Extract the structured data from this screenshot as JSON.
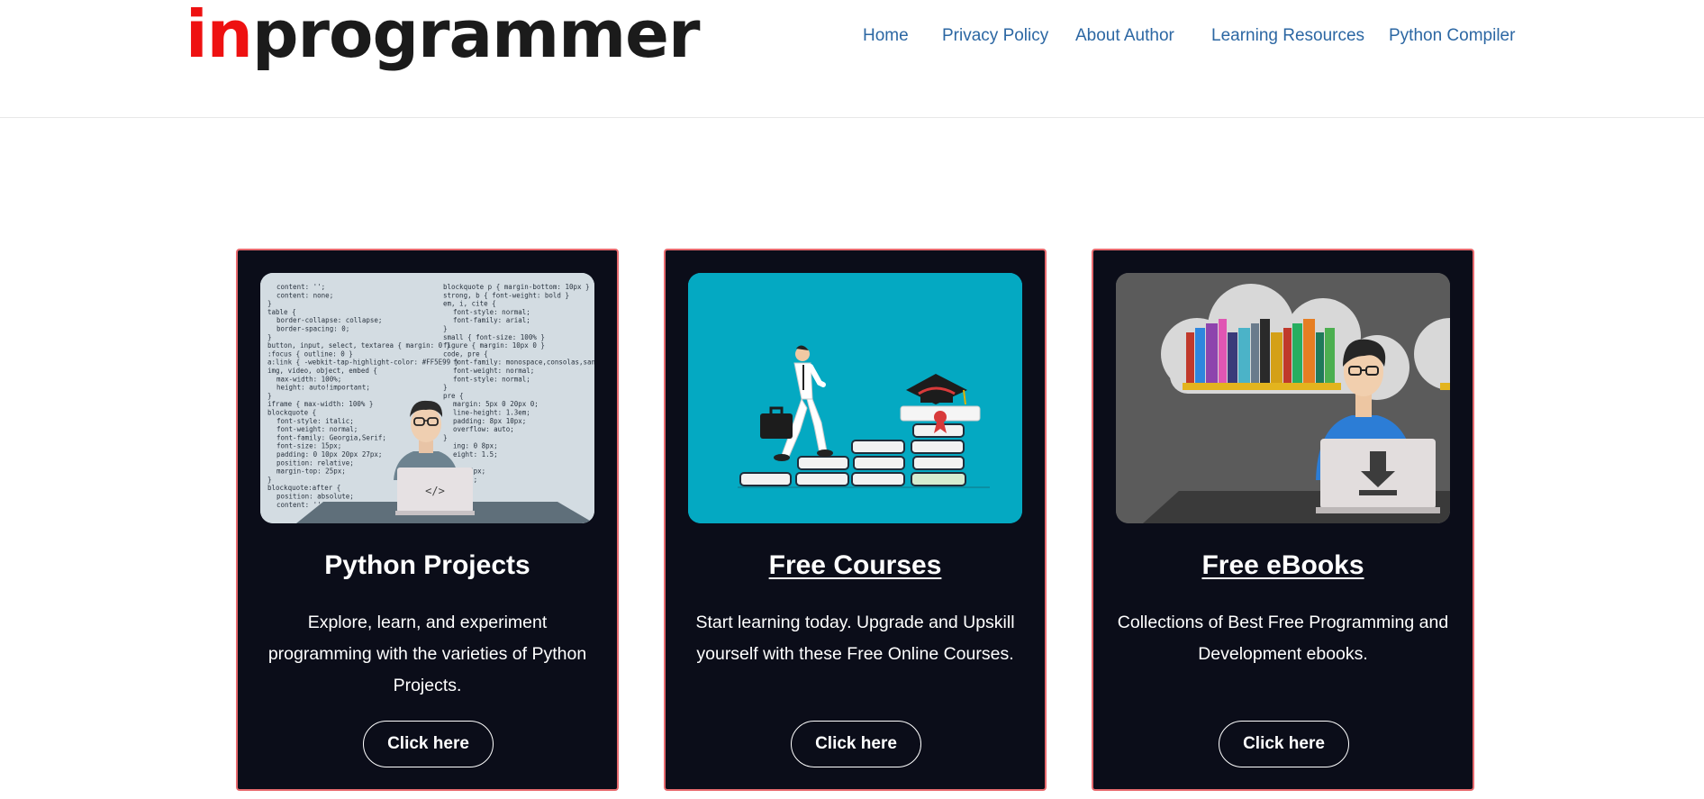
{
  "logo": {
    "part1": "in",
    "part2": "programmer"
  },
  "nav": [
    {
      "label": "Home"
    },
    {
      "label": "Privacy Policy"
    },
    {
      "label": "About Author"
    },
    {
      "label": "Learning Resources"
    },
    {
      "label": "Python Compiler"
    }
  ],
  "cards": [
    {
      "title": "Python Projects",
      "description": "Explore, learn, and experiment programming with the varieties of Python Projects.",
      "button": "Click here",
      "image": {
        "left_code": [
          "content: '';",
          "content: none;",
          "}",
          "table {",
          "border-collapse: collapse;",
          "border-spacing: 0;",
          "}",
          "button, input, select, textarea { margin: 0 }",
          ":focus { outline: 0 }",
          "a:link { -webkit-tap-highlight-color: #FF5E99 }",
          "img, video, object, embed {",
          "max-width: 100%;",
          "height: auto!important;",
          "}",
          "iframe { max-width: 100% }",
          "blockquote {",
          "font-style: italic;",
          "font-weight: normal;",
          "font-family: Georgia,Serif;",
          "font-size: 15px;",
          "padding: 0 10px 20px 27px;",
          "position: relative;",
          "margin-top: 25px;",
          "}",
          "blockquote:after {",
          "position: absolute;",
          "content: '';"
        ],
        "right_code": [
          "blockquote p { margin-bottom: 10px }",
          "strong, b { font-weight: bold }",
          "em, i, cite {",
          "font-style: normal;",
          "font-family: arial;",
          "}",
          "small { font-size: 100% }",
          "figure { margin: 10px 0 }",
          "code, pre {",
          "font-family: monospace,consolas,sans-",
          "font-weight: normal;",
          "font-style: normal;",
          "}",
          "pre {",
          "margin: 5px 0 20px 0;",
          "line-height: 1.3em;",
          "padding: 8px 10px;",
          "overflow: auto;",
          "}",
          "ing: 0 8px;",
          "eight: 1.5;",
          "",
          "1px 6px;",
          "0 2px;",
          "lack"
        ],
        "laptop_label": "</>"
      }
    },
    {
      "title": "Free Courses",
      "description": "Start learning today. Upgrade and Upskill yourself with these Free Online Courses.",
      "button": "Click here"
    },
    {
      "title": "Free eBooks",
      "description": "Collections of Best Free Programming and Development ebooks.",
      "button": "Click here"
    }
  ],
  "colors": {
    "logo_red": "#ee1111",
    "logo_dark": "#1b1b1b",
    "nav_link": "#2c67a3",
    "card_bg": "#0b0d19",
    "card_border": "#e76a6e",
    "courses_bg": "#04a9c2",
    "ebooks_bg": "#5a5a5a"
  },
  "icons": [
    "developer-illustration",
    "graduation-stairs-illustration",
    "ebook-download-illustration"
  ]
}
